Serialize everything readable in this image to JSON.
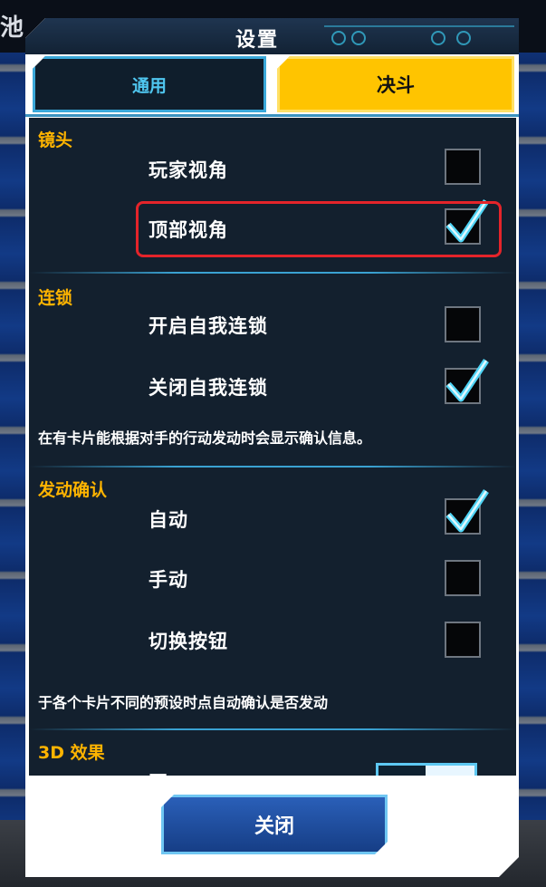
{
  "background": {
    "top_text": "池"
  },
  "dialog": {
    "title": "设置"
  },
  "tabs": [
    {
      "label": "通用",
      "active": false
    },
    {
      "label": "决斗",
      "active": true
    }
  ],
  "sections": {
    "camera": {
      "title": "镜头",
      "options": [
        {
          "label": "玩家视角",
          "checked": false
        },
        {
          "label": "顶部视角",
          "checked": true
        }
      ]
    },
    "chain": {
      "title": "连锁",
      "options": [
        {
          "label": "开启自我连锁",
          "checked": false
        },
        {
          "label": "关闭自我连锁",
          "checked": true
        }
      ],
      "description": "在有卡片能根据对手的行动发动时会显示确认信息。"
    },
    "activation": {
      "title": "发动确认",
      "options": [
        {
          "label": "自动",
          "checked": true
        },
        {
          "label": "手动",
          "checked": false
        },
        {
          "label": "切换按钮",
          "checked": false
        }
      ],
      "description": "于各个卡片不同的预设时点自动确认是否发动"
    },
    "effects3d": {
      "title": "3D 效果",
      "partial_label": "开"
    }
  },
  "close_button": {
    "label": "关闭"
  },
  "colors": {
    "section_title": "#ffb400",
    "tab_active": "#ffc400",
    "tab_inactive_text": "#4fc6ef",
    "highlight_border": "#e4242a",
    "check": "#4fd4f5"
  }
}
